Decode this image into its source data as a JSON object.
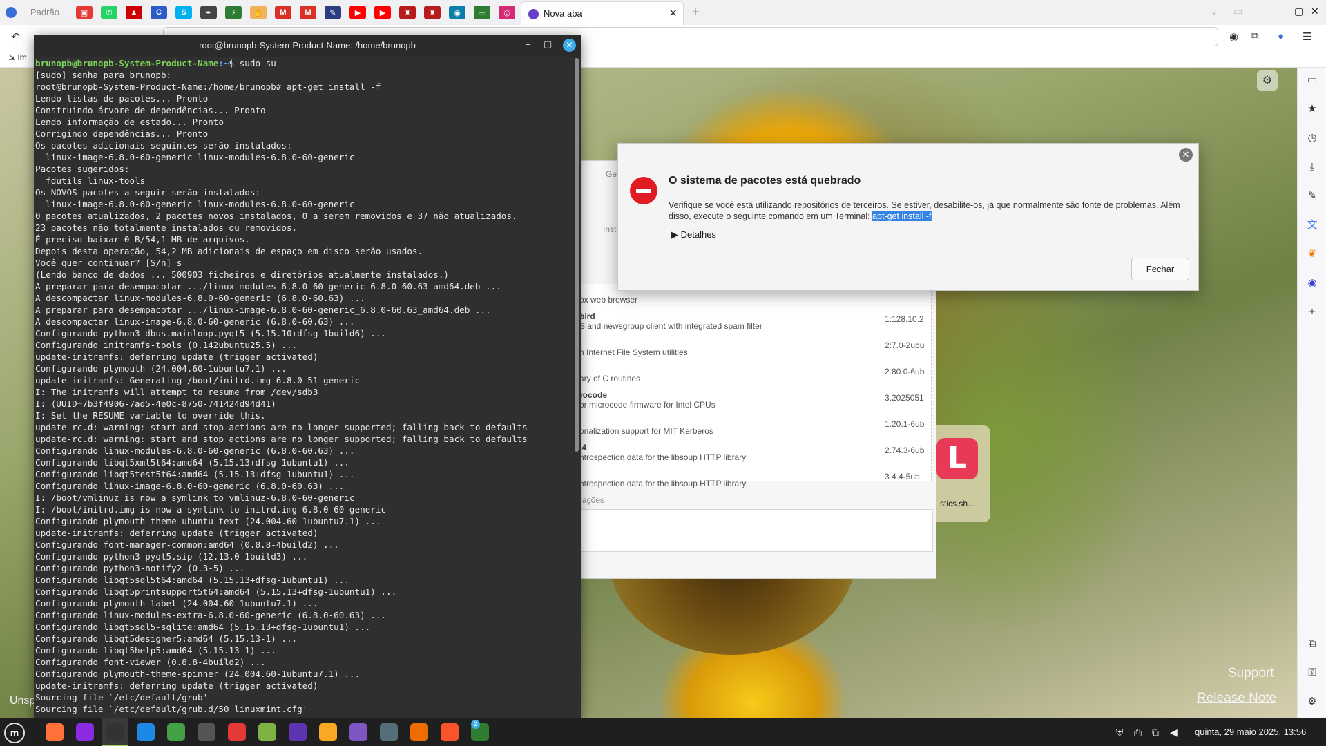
{
  "browser": {
    "profile_label": "Padrão",
    "active_tab_title": "Nova aba",
    "tab_close": "✕",
    "new_tab": "+",
    "bookmark_item": "Im",
    "pinned_tabs": [
      {
        "icon": "red-bag-icon",
        "color": "#e53935",
        "glyph": "▣"
      },
      {
        "icon": "whatsapp-icon",
        "color": "#25d366",
        "glyph": "✆"
      },
      {
        "icon": "red-hat-icon",
        "color": "#cc0000",
        "glyph": "▲"
      },
      {
        "icon": "blue-c-icon",
        "color": "#2c5cc5",
        "glyph": "C"
      },
      {
        "icon": "skype-icon",
        "color": "#00aff0",
        "glyph": "S"
      },
      {
        "icon": "pen-icon",
        "color": "#444444",
        "glyph": "✒"
      },
      {
        "icon": "bolt-icon",
        "color": "#2e7d32",
        "glyph": "⚡"
      },
      {
        "icon": "hand-icon",
        "color": "#f0b35a",
        "glyph": "✋"
      },
      {
        "icon": "gmail-icon",
        "color": "#d93025",
        "glyph": "M"
      },
      {
        "icon": "gmail-icon-2",
        "color": "#d93025",
        "glyph": "M"
      },
      {
        "icon": "note-icon",
        "color": "#2c3e80",
        "glyph": "✎"
      },
      {
        "icon": "youtube-icon",
        "color": "#ff0000",
        "glyph": "▶"
      },
      {
        "icon": "youtube-icon-2",
        "color": "#ff0000",
        "glyph": "▶"
      },
      {
        "icon": "shield-red-icon",
        "color": "#b71c1c",
        "glyph": "♜"
      },
      {
        "icon": "shield-red-icon-2",
        "color": "#b71c1c",
        "glyph": "♜"
      },
      {
        "icon": "circle-blue-icon",
        "color": "#0a7fa8",
        "glyph": "◉"
      },
      {
        "icon": "list-green-icon",
        "color": "#2e7d32",
        "glyph": "☰"
      },
      {
        "icon": "instagram-icon",
        "color": "#d62976",
        "glyph": "◎"
      }
    ]
  },
  "ntp": {
    "settings_icon": "⚙",
    "shortcut_letter": "L",
    "shortcut_name": "stics.sh...",
    "support_link": "Support",
    "release_link": "Release Note",
    "unsp_text": "Unsp"
  },
  "sidebar": {
    "icons": [
      {
        "name": "wallet-icon",
        "glyph": "▭",
        "color": "#333333"
      },
      {
        "name": "bookmark-star-icon",
        "glyph": "★",
        "color": "#333333"
      },
      {
        "name": "history-icon",
        "glyph": "◷",
        "color": "#333333"
      },
      {
        "name": "download-icon",
        "glyph": "⤓",
        "color": "#333333"
      },
      {
        "name": "pencil-icon",
        "glyph": "✎",
        "color": "#333333"
      },
      {
        "name": "translate-icon",
        "glyph": "文",
        "color": "#4285f4"
      },
      {
        "name": "leaf-icon",
        "glyph": "❦",
        "color": "#f57c00"
      },
      {
        "name": "messenger-icon",
        "glyph": "◉",
        "color": "#3b3bd6"
      },
      {
        "name": "add-panel-icon",
        "glyph": "+",
        "color": "#333333"
      }
    ],
    "bottom_icons": [
      {
        "name": "extensions-icon",
        "glyph": "⧉",
        "color": "#333333"
      },
      {
        "name": "key-icon",
        "glyph": "⚿",
        "color": "#333333"
      },
      {
        "name": "settings-gear-icon",
        "glyph": "⚙",
        "color": "#333333"
      }
    ]
  },
  "software_manager": {
    "top_label_1": "Ger",
    "top_label_2": "Inst",
    "rows": [
      {
        "name": "",
        "desc": "ox web browser",
        "ver": ""
      },
      {
        "name": "bird",
        "desc": "S and newsgroup client with integrated spam filter",
        "ver": "1:128.10.2"
      },
      {
        "name": "",
        "desc": "n Internet File System utilities",
        "ver": "2:7.0-2ubu"
      },
      {
        "name": "",
        "desc": "ary of C routines",
        "ver": "2.80.0-6ub"
      },
      {
        "name": "rocode",
        "desc": "or microcode firmware for Intel CPUs",
        "ver": "3.2025051"
      },
      {
        "name": "",
        "desc": "onalization support for MIT Kerberos",
        "ver": "1.20.1-6ub"
      },
      {
        "name": ".4",
        "desc": "ntrospection data for the libsoup HTTP library",
        "ver": "2.74.3-6ub"
      },
      {
        "name": "",
        "desc": "ntrospection data for the libsoup HTTP library",
        "ver": "3.4.4-5ub"
      }
    ],
    "section_label": "rações"
  },
  "dialog": {
    "title": "O sistema de pacotes está quebrado",
    "message": "Verifique se você está utilizando repositórios de terceiros. Se estiver, desabilite-os, já que normalmente são fonte de problemas. Além disso, execute o seguinte comando em um Terminal: ",
    "command": "apt-get install -f",
    "details_label": "Detalhes",
    "close_button": "Fechar",
    "close_icon": "✕"
  },
  "terminal": {
    "title": "root@brunopb-System-Product-Name: /home/brunopb",
    "prompt_user": "brunopb@brunopb-System-Product-Name",
    "prompt_path": ":~",
    "first_command": "$ sudo su",
    "lines": [
      "[sudo] senha para brunopb:",
      "root@brunopb-System-Product-Name:/home/brunopb# apt-get install -f",
      "Lendo listas de pacotes... Pronto",
      "Construindo árvore de dependências... Pronto",
      "Lendo informação de estado... Pronto",
      "Corrigindo dependências... Pronto",
      "Os pacotes adicionais seguintes serão instalados:",
      "  linux-image-6.8.0-60-generic linux-modules-6.8.0-60-generic",
      "Pacotes sugeridos:",
      "  fdutils linux-tools",
      "Os NOVOS pacotes a seguir serão instalados:",
      "  linux-image-6.8.0-60-generic linux-modules-6.8.0-60-generic",
      "0 pacotes atualizados, 2 pacotes novos instalados, 0 a serem removidos e 37 não atualizados.",
      "23 pacotes não totalmente instalados ou removidos.",
      "É preciso baixar 0 B/54,1 MB de arquivos.",
      "Depois desta operação, 54,2 MB adicionais de espaço em disco serão usados.",
      "Você quer continuar? [S/n] s",
      "(Lendo banco de dados ... 500903 ficheiros e diretórios atualmente instalados.)",
      "A preparar para desempacotar .../linux-modules-6.8.0-60-generic_6.8.0-60.63_amd64.deb ...",
      "A descompactar linux-modules-6.8.0-60-generic (6.8.0-60.63) ...",
      "A preparar para desempacotar .../linux-image-6.8.0-60-generic_6.8.0-60.63_amd64.deb ...",
      "A descompactar linux-image-6.8.0-60-generic (6.8.0-60.63) ...",
      "Configurando python3-dbus.mainloop.pyqt5 (5.15.10+dfsg-1build6) ...",
      "Configurando initramfs-tools (0.142ubuntu25.5) ...",
      "update-initramfs: deferring update (trigger activated)",
      "Configurando plymouth (24.004.60-1ubuntu7.1) ...",
      "update-initramfs: Generating /boot/initrd.img-6.8.0-51-generic",
      "I: The initramfs will attempt to resume from /dev/sdb3",
      "I: (UUID=7b3f4906-7ad5-4e0c-8750-741424d94d41)",
      "I: Set the RESUME variable to override this.",
      "update-rc.d: warning: start and stop actions are no longer supported; falling back to defaults",
      "update-rc.d: warning: start and stop actions are no longer supported; falling back to defaults",
      "Configurando linux-modules-6.8.0-60-generic (6.8.0-60.63) ...",
      "Configurando libqt5xml5t64:amd64 (5.15.13+dfsg-1ubuntu1) ...",
      "Configurando libqt5test5t64:amd64 (5.15.13+dfsg-1ubuntu1) ...",
      "Configurando linux-image-6.8.0-60-generic (6.8.0-60.63) ...",
      "I: /boot/vmlinuz is now a symlink to vmlinuz-6.8.0-60-generic",
      "I: /boot/initrd.img is now a symlink to initrd.img-6.8.0-60-generic",
      "Configurando plymouth-theme-ubuntu-text (24.004.60-1ubuntu7.1) ...",
      "update-initramfs: deferring update (trigger activated)",
      "Configurando font-manager-common:amd64 (0.8.8-4build2) ...",
      "Configurando python3-pyqt5.sip (12.13.0-1build3) ...",
      "Configurando python3-notify2 (0.3-5) ...",
      "Configurando libqt5sql5t64:amd64 (5.15.13+dfsg-1ubuntu1) ...",
      "Configurando libqt5printsupport5t64:amd64 (5.15.13+dfsg-1ubuntu1) ...",
      "Configurando plymouth-label (24.004.60-1ubuntu7.1) ...",
      "Configurando linux-modules-extra-6.8.0-60-generic (6.8.0-60.63) ...",
      "Configurando libqt5sql5-sqlite:amd64 (5.15.13+dfsg-1ubuntu1) ...",
      "Configurando libqt5designer5:amd64 (5.15.13-1) ...",
      "Configurando libqt5help5:amd64 (5.15.13-1) ...",
      "Configurando font-viewer (0.8.8-4build2) ...",
      "Configurando plymouth-theme-spinner (24.004.60-1ubuntu7.1) ...",
      "update-initramfs: deferring update (trigger activated)",
      "Sourcing file `/etc/default/grub'",
      "Sourcing file `/etc/default/grub.d/50_linuxmint.cfg'"
    ]
  },
  "taskbar": {
    "menu_label": "m",
    "apps": [
      {
        "name": "firefox-icon",
        "color": "#ff7139"
      },
      {
        "name": "podcast-icon",
        "color": "#8a2be2"
      },
      {
        "name": "terminal-icon",
        "color": "#333333"
      },
      {
        "name": "text-editor-icon",
        "color": "#1e88e5"
      },
      {
        "name": "spreadsheet-icon",
        "color": "#43a047"
      },
      {
        "name": "package-icon",
        "color": "#555555"
      },
      {
        "name": "pdf-tool-icon",
        "color": "#e53935"
      },
      {
        "name": "android-icon",
        "color": "#7cb342"
      },
      {
        "name": "launcher-icon",
        "color": "#5e35b1"
      },
      {
        "name": "files-icon",
        "color": "#f9a825"
      },
      {
        "name": "network-icon",
        "color": "#7e57c2"
      },
      {
        "name": "calculator-icon",
        "color": "#546e7a"
      },
      {
        "name": "archive-icon",
        "color": "#ef6c00"
      },
      {
        "name": "brave-icon",
        "color": "#fb542b"
      },
      {
        "name": "shield-update-icon",
        "color": "#2e7d32"
      }
    ],
    "update_badge": "2",
    "clock": "quinta, 29 maio 2025, 13:56"
  }
}
